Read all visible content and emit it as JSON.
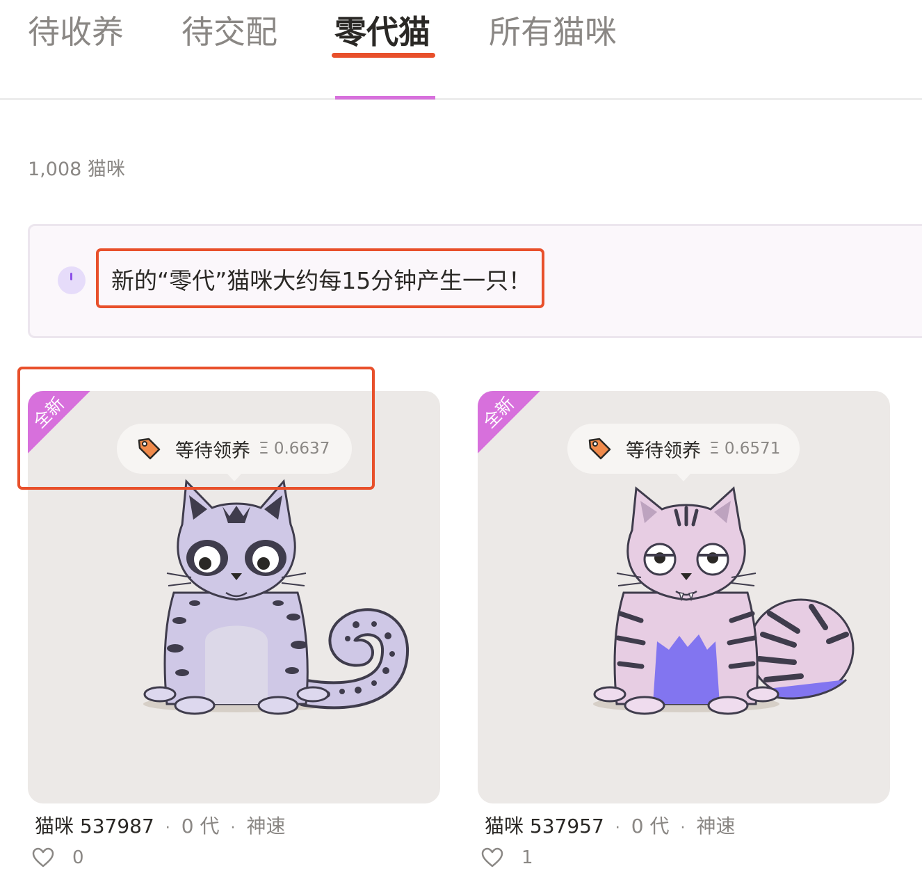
{
  "tabs": [
    {
      "label": "待收养",
      "active": false
    },
    {
      "label": "待交配",
      "active": false
    },
    {
      "label": "零代猫",
      "active": true
    },
    {
      "label": "所有猫咪",
      "active": false
    }
  ],
  "count_label": "1,008 猫咪",
  "notice": {
    "icon": "info-icon",
    "text": "新的“零代”猫咪大约每15分钟产生一只！"
  },
  "colors": {
    "accent": "#d770dc",
    "highlight": "#e8502b",
    "tag_orange": "#f08a4b"
  },
  "cards": [
    {
      "ribbon": "全新",
      "status": "等待领养",
      "price": "Ξ 0.6637",
      "name": "猫咪 537987",
      "generation": "0 代",
      "speed": "神速",
      "likes": "0"
    },
    {
      "ribbon": "全新",
      "status": "等待领养",
      "price": "Ξ 0.6571",
      "name": "猫咪 537957",
      "generation": "0 代",
      "speed": "神速",
      "likes": "1"
    }
  ]
}
